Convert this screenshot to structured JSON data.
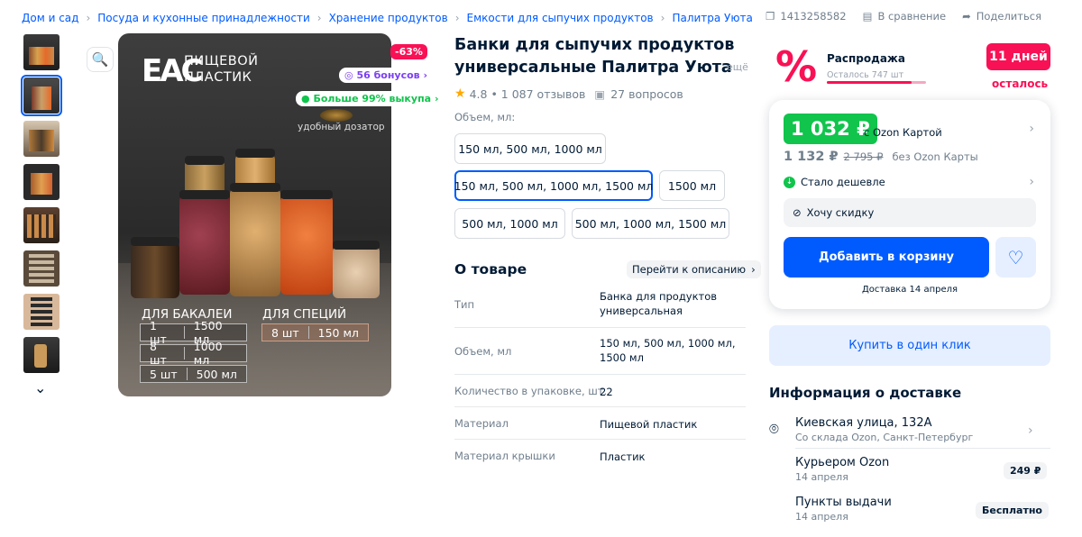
{
  "breadcrumb": [
    "Дом и сад",
    "Посуда и кухонные принадлежности",
    "Хранение продуктов",
    "Емкости для сыпучих продуктов",
    "Палитра Уюта"
  ],
  "top": {
    "sku": "1413258582",
    "compare": "В сравнение",
    "share": "Поделиться"
  },
  "image": {
    "discount": "-63%",
    "bonus": "56 бонусов",
    "buyout": "Больше 99% выкупа",
    "mark": "ЕАС",
    "material": "ПИЩЕВОЙ\nПЛАСТИК",
    "dispenser": "удобный дозатор",
    "group1": "ДЛЯ БАКАЛЕИ",
    "group2": "ДЛЯ СПЕЦИЙ",
    "rows": [
      {
        "q": "1 шт",
        "v": "1500 мл"
      },
      {
        "q": "8 шт",
        "v": "1000 мл"
      },
      {
        "q": "5 шт",
        "v": "500 мл"
      }
    ],
    "spice": {
      "q": "8 шт",
      "v": "150 мл"
    }
  },
  "product": {
    "title": "Банки для сыпучих продуктов универсальные Палитра Уюта",
    "more": "ещё",
    "rating": "4.8",
    "reviews": "• 1 087 отзывов",
    "questions": "27 вопросов",
    "volume_label": "Объем, мл:",
    "options": [
      "150 мл, 500 мл, 1000 мл",
      "150 мл, 500 мл, 1000 мл, 1500 мл",
      "1500 мл",
      "500 мл, 1000 мл",
      "500 мл, 1000 мл, 1500 мл"
    ]
  },
  "about": {
    "title": "О товаре",
    "link": "Перейти к описанию",
    "specs": [
      {
        "k": "Тип",
        "v": "Банка для продуктов универсальная"
      },
      {
        "k": "Объем, мл",
        "v": "150 мл, 500 мл, 1000 мл, 1500 мл"
      },
      {
        "k": "Количество в упаковке, шт.",
        "v": "22"
      },
      {
        "k": "Материал",
        "v": "Пищевой пластик"
      },
      {
        "k": "Материал крышки",
        "v": "Пластик"
      }
    ]
  },
  "sale": {
    "icon": "%",
    "title": "Распродажа",
    "left": "Осталось 747 шт",
    "progress": 0.85,
    "days": "11 дней",
    "days_left": "осталось"
  },
  "price": {
    "card_price": "1 032 ₽",
    "card_label": "с Ozon Картой",
    "price": "1 132 ₽",
    "old": "2 795 ₽",
    "no_card": "без Ozon Карты",
    "cheaper": "Стало дешевле",
    "discount_want": "Хочу скидку",
    "add": "Добавить в корзину",
    "delivery": "Доставка 14 апреля",
    "one_click": "Купить в один клик"
  },
  "delivery": {
    "title": "Информация о доставке",
    "address": "Киевская улица, 132А",
    "warehouse": "Со склада Ozon, Санкт-Петербург",
    "courier": "Курьером Ozon",
    "courier_date": "14 апреля",
    "courier_price": "249 ₽",
    "pickup": "Пункты выдачи",
    "pickup_date": "14 апреля",
    "pickup_price": "Бесплатно"
  },
  "colors": {
    "accent": "#005bff",
    "sale": "#f91155",
    "green": "#10c44c"
  }
}
